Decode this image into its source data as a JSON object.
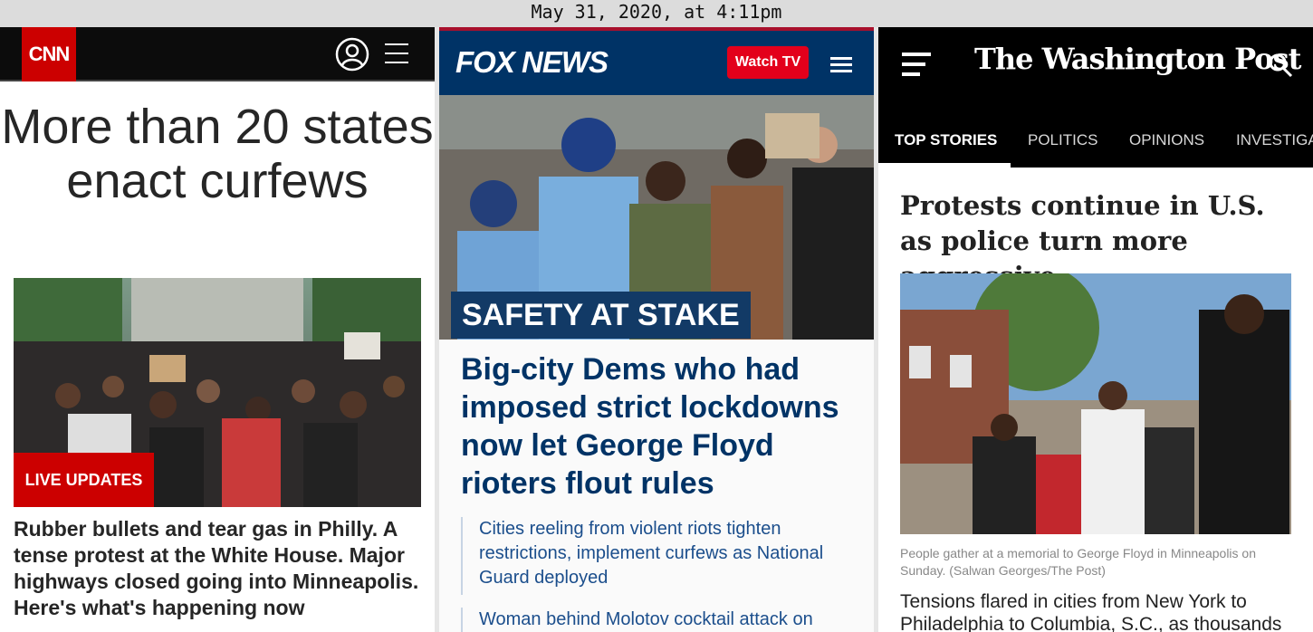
{
  "timestamp": "May 31, 2020, at 4:11pm",
  "cnn": {
    "logo": "CNN",
    "headline": "More than 20 states enact curfews",
    "live_badge": "LIVE UPDATES",
    "summary": "Rubber bullets and tear gas in Philly. A tense protest at the White House. Major highways closed going into Minneapolis. Here's what's happening now"
  },
  "fox": {
    "logo": "FOX NEWS",
    "watch_label": "Watch TV",
    "kicker": "SAFETY AT STAKE",
    "headline": "Big-city Dems who had imposed strict lockdowns now let George Floyd rioters flout rules",
    "related": [
      "Cities reeling from violent riots tighten restrictions, implement curfews as National Guard deployed",
      "Woman behind Molotov cocktail attack on"
    ]
  },
  "wapo": {
    "logo": "The Washington Post",
    "tabs": [
      "TOP STORIES",
      "POLITICS",
      "OPINIONS",
      "INVESTIGA"
    ],
    "headline": "Protests continue in U.S. as police turn more aggressive",
    "caption": "People gather at a memorial to George Floyd in Minneapolis on Sunday. (Salwan Georges/The Post)",
    "body": "Tensions flared in cities from New York to Philadelphia to Columbia, S.C., as thousands"
  }
}
